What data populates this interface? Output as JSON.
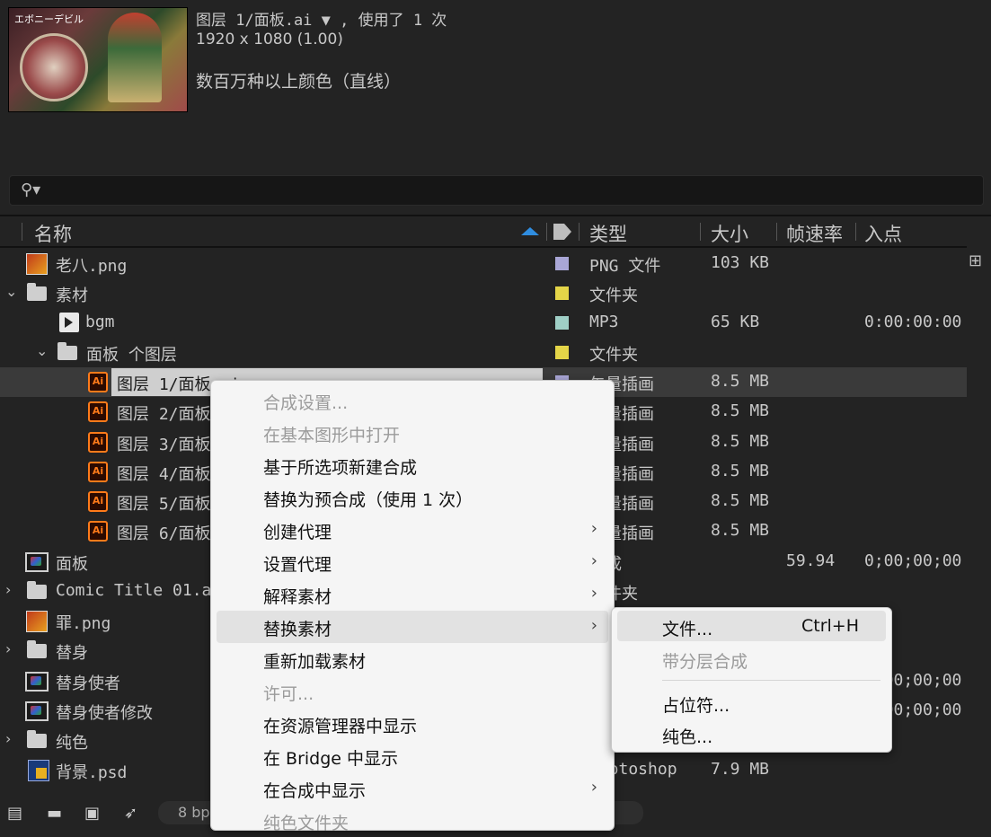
{
  "preview": {
    "filename": "图层 1/面板.ai ▼ , 使用了 1 次",
    "resolution": "1920 x 1080 (1.00)",
    "color_depth": "数百万种以上颜色（直线）",
    "thumb_caption": "エボニーデビル"
  },
  "search": {
    "icon": "search-icon",
    "symbol": "⚲▾"
  },
  "columns": {
    "name": "名称",
    "type": "类型",
    "size": "大小",
    "fps": "帧速率",
    "inpoint": "入点"
  },
  "rows": [
    {
      "name": "老八.png",
      "type": "PNG 文件",
      "size": "103 KB",
      "fps": "",
      "in": "",
      "label": "#a9a6d6"
    },
    {
      "name": "素材",
      "type": "文件夹",
      "size": "",
      "fps": "",
      "in": "",
      "label": "#e4d548"
    },
    {
      "name": "bgm",
      "type": "MP3",
      "size": "65 KB",
      "fps": "",
      "in": "0:00:00:00",
      "label": "#9fcfc6"
    },
    {
      "name": "面板 个图层",
      "type": "文件夹",
      "size": "",
      "fps": "",
      "in": "",
      "label": "#e4d548"
    },
    {
      "name": "图层 1/面板.ai",
      "type": "矢量插画",
      "size": "8.5 MB",
      "fps": "",
      "in": "",
      "label": "#a9a6d6"
    },
    {
      "name": "图层 2/面板",
      "type": "矢量插画",
      "size": "8.5 MB",
      "fps": "",
      "in": "",
      "label": "#a9a6d6"
    },
    {
      "name": "图层 3/面板",
      "type": "矢量插画",
      "size": "8.5 MB",
      "fps": "",
      "in": "",
      "label": "#a9a6d6"
    },
    {
      "name": "图层 4/面板",
      "type": "矢量插画",
      "size": "8.5 MB",
      "fps": "",
      "in": "",
      "label": "#a9a6d6"
    },
    {
      "name": "图层 5/面板",
      "type": "矢量插画",
      "size": "8.5 MB",
      "fps": "",
      "in": "",
      "label": "#a9a6d6"
    },
    {
      "name": "图层 6/面板",
      "type": "矢量插画",
      "size": "8.5 MB",
      "fps": "",
      "in": "",
      "label": "#a9a6d6"
    },
    {
      "name": "面板",
      "type": "合成",
      "size": "",
      "fps": "59.94",
      "in": "0;00;00;00",
      "label": ""
    },
    {
      "name": "Comic Title 01.aep",
      "type": "文件夹",
      "size": "",
      "fps": "",
      "in": "",
      "label": ""
    },
    {
      "name": "罪.png",
      "type": "",
      "size": "",
      "fps": "",
      "in": "",
      "label": ""
    },
    {
      "name": "替身",
      "type": "",
      "size": "",
      "fps": "",
      "in": "",
      "label": ""
    },
    {
      "name": "替身使者",
      "type": "",
      "size": "",
      "fps": "",
      "in": "0;00;00;00",
      "label": ""
    },
    {
      "name": "替身使者修改",
      "type": "",
      "size": "",
      "fps": "",
      "in": "0;00;00;00",
      "label": ""
    },
    {
      "name": "纯色",
      "type": "",
      "size": "",
      "fps": "",
      "in": "",
      "label": ""
    },
    {
      "name": "背景.psd",
      "type": "Photoshop",
      "size": "7.9 MB",
      "fps": "",
      "in": "",
      "label": ""
    }
  ],
  "bottom": {
    "bpc": "8 bpc"
  },
  "context_menu": [
    {
      "label": "合成设置...",
      "disabled": true
    },
    {
      "label": "在基本图形中打开",
      "disabled": true
    },
    {
      "label": "基于所选项新建合成",
      "disabled": false
    },
    {
      "label": "替换为预合成（使用 1 次）",
      "disabled": false
    },
    {
      "label": "创建代理",
      "disabled": false,
      "submenu": true
    },
    {
      "label": "设置代理",
      "disabled": false,
      "submenu": true
    },
    {
      "label": "解释素材",
      "disabled": false,
      "submenu": true
    },
    {
      "label": "替换素材",
      "disabled": false,
      "submenu": true,
      "highlight": true
    },
    {
      "label": "重新加载素材",
      "disabled": false
    },
    {
      "label": "许可...",
      "disabled": true
    },
    {
      "label": "在资源管理器中显示",
      "disabled": false
    },
    {
      "label": "在 Bridge 中显示",
      "disabled": false
    },
    {
      "label": "在合成中显示",
      "disabled": false,
      "submenu": true
    },
    {
      "label": "纯色文件夹",
      "disabled": true
    }
  ],
  "submenu": [
    {
      "label": "文件...",
      "shortcut": "Ctrl+H",
      "disabled": false,
      "highlight": true
    },
    {
      "label": "带分层合成",
      "disabled": true
    },
    {
      "label": "占位符...",
      "disabled": false
    },
    {
      "label": "纯色...",
      "disabled": false
    }
  ],
  "submenu_arrow": "›"
}
